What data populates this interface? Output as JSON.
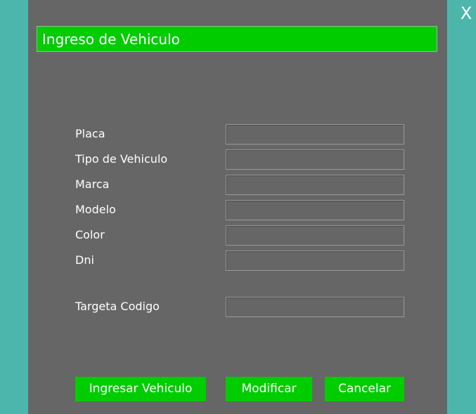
{
  "window": {
    "close_label": "X",
    "title": "Ingreso de Vehiculo"
  },
  "form": {
    "fields": [
      {
        "label": "Placa",
        "value": ""
      },
      {
        "label": "Tipo de Vehiculo",
        "value": ""
      },
      {
        "label": "Marca",
        "value": ""
      },
      {
        "label": "Modelo",
        "value": ""
      },
      {
        "label": "Color",
        "value": ""
      },
      {
        "label": "Dni",
        "value": ""
      },
      {
        "label": "Targeta Codigo",
        "value": ""
      }
    ]
  },
  "buttons": {
    "ingresar": "Ingresar Vehiculo",
    "modificar": "Modificar",
    "cancelar": "Cancelar"
  },
  "colors": {
    "background": "#4db6ac",
    "panel": "#666666",
    "accent": "#00cc00",
    "text": "#ffffff"
  }
}
